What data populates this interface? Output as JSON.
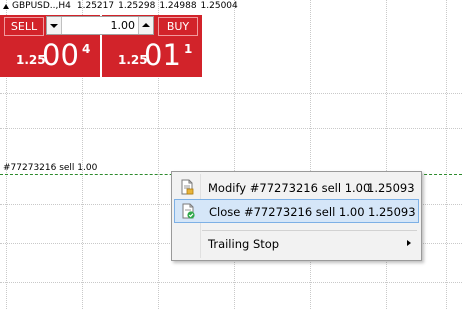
{
  "chart_header": {
    "symbol": "GBPUSD..,H4",
    "open": "1.25217",
    "high": "1.25298",
    "low": "1.24988",
    "close": "1.25004"
  },
  "trade_panel": {
    "sell_label": "SELL",
    "buy_label": "BUY",
    "lot_value": "1.00",
    "bid": {
      "prefix": "1.25",
      "big": "00",
      "sup": "4"
    },
    "ask": {
      "prefix": "1.25",
      "big": "01",
      "sup": "1"
    },
    "panel_color": "#d2232a"
  },
  "order_line": {
    "label": "#77273216 sell 1.00",
    "color": "#2e8b2e"
  },
  "context_menu": {
    "items": [
      {
        "icon": "modify-order-icon",
        "label": "Modify #77273216 sell 1.00",
        "price": "1.25093"
      },
      {
        "icon": "close-order-icon",
        "label": "Close #77273216 sell 1.00",
        "price": "1.25093"
      },
      {
        "icon": "chevron-right-icon",
        "label": "Trailing Stop",
        "price": ""
      }
    ],
    "hover_color": "#d5e6f8"
  }
}
